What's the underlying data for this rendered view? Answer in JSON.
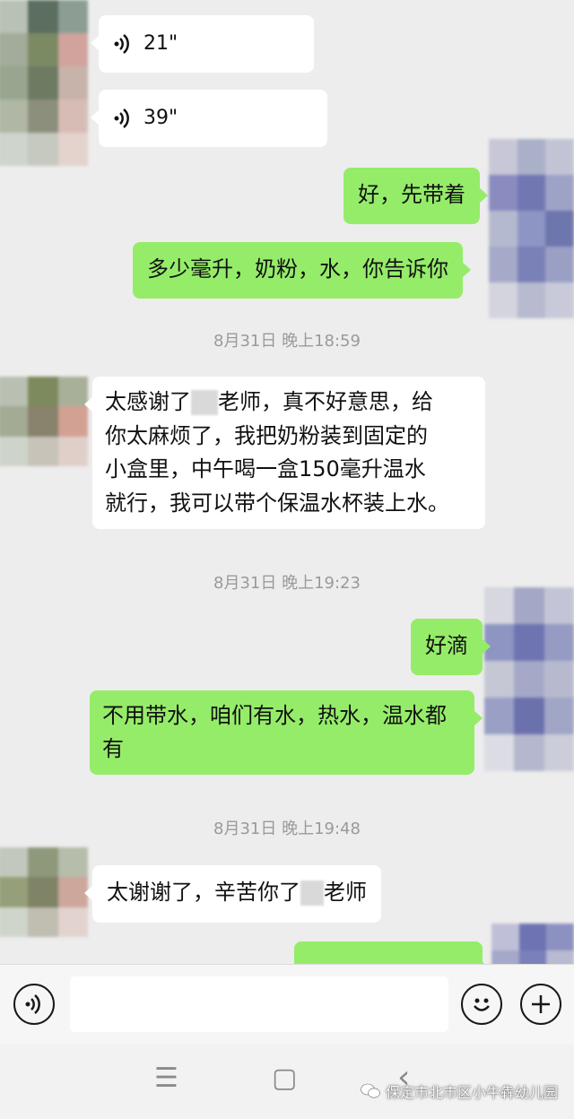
{
  "messages": [
    {
      "type": "voice",
      "duration": "21\""
    },
    {
      "type": "voice",
      "duration": "39\""
    },
    {
      "type": "text",
      "text": "好，先带着"
    },
    {
      "type": "text",
      "text": "多少毫升，奶粉，水，你告诉你"
    },
    {
      "type": "time",
      "text": "8月31日 晚上18:59"
    },
    {
      "type": "text",
      "lines": [
        "太感谢了",
        "老师，真不好意思，给",
        "你太麻烦了，我把奶粉装到固定的",
        "小盒里，中午喝一盒150毫升温水",
        "就行，我可以带个保温水杯装上水。"
      ]
    },
    {
      "type": "time",
      "text": "8月31日 晚上19:23"
    },
    {
      "type": "text",
      "text": "好滴"
    },
    {
      "type": "text",
      "lines": [
        "不用带水，咱们有水，热水，温水都",
        "有"
      ]
    },
    {
      "type": "time",
      "text": "8月31日 晚上19:48"
    },
    {
      "type": "text",
      "parts": [
        "太谢谢了，辛苦你了",
        "老师"
      ]
    }
  ],
  "input_bar": {
    "voice_icon": "voice-input-icon",
    "emoji_icon": "emoji-icon",
    "plus_icon": "plus-icon"
  },
  "nav": {
    "menu_glyph": "☰",
    "home_glyph": "▢",
    "back_glyph": "‹"
  },
  "watermark": "保定市北市区小牛犇幼儿园",
  "colors": {
    "background": "#ededed",
    "bubble_self": "#95ec69",
    "bubble_other": "#ffffff",
    "time_text": "#9a9a9a"
  }
}
